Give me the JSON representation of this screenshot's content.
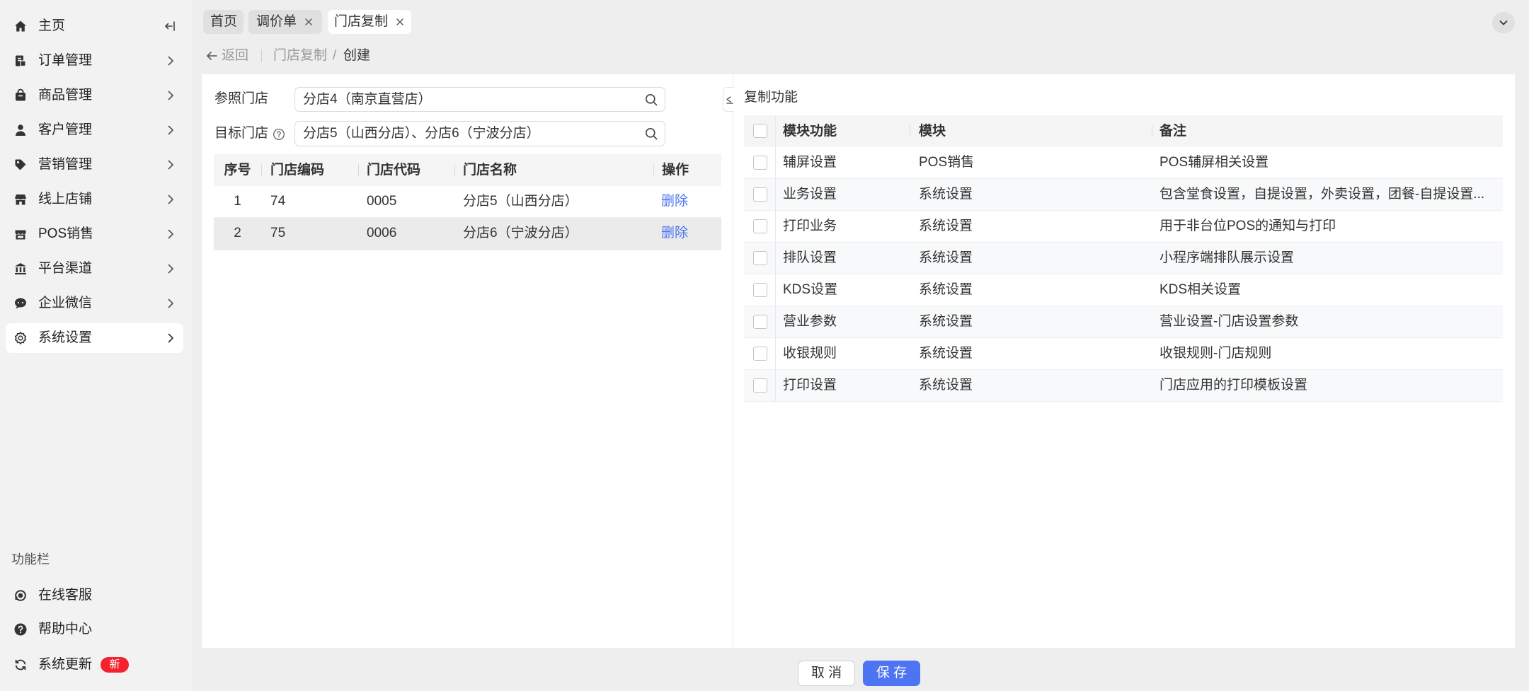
{
  "colors": {
    "accent": "#4d74f2",
    "link": "#4d74f2",
    "badge": "#f5222d"
  },
  "sidebar": {
    "collapse_icon": "collapse-left-icon",
    "items": [
      {
        "label": "主页",
        "icon": "home-icon",
        "active": false
      },
      {
        "label": "订单管理",
        "icon": "order-icon",
        "active": false
      },
      {
        "label": "商品管理",
        "icon": "product-icon",
        "active": false
      },
      {
        "label": "客户管理",
        "icon": "customer-icon",
        "active": false
      },
      {
        "label": "营销管理",
        "icon": "tag-icon",
        "active": false
      },
      {
        "label": "线上店铺",
        "icon": "shop-icon",
        "active": false
      },
      {
        "label": "POS销售",
        "icon": "store-icon",
        "active": false
      },
      {
        "label": "平台渠道",
        "icon": "bank-icon",
        "active": false
      },
      {
        "label": "企业微信",
        "icon": "chat-icon",
        "active": false
      },
      {
        "label": "系统设置",
        "icon": "gear-icon",
        "active": true
      }
    ],
    "function_bar": {
      "title": "功能栏",
      "items": [
        {
          "label": "在线客服",
          "icon": "headset-icon"
        },
        {
          "label": "帮助中心",
          "icon": "help-icon"
        },
        {
          "label": "系统更新",
          "icon": "refresh-icon",
          "badge": "新"
        }
      ]
    }
  },
  "tabs": [
    {
      "label": "首页",
      "closable": false,
      "active": false
    },
    {
      "label": "调价单",
      "closable": true,
      "active": false
    },
    {
      "label": "门店复制",
      "closable": true,
      "active": true
    }
  ],
  "breadcrumb": {
    "back": "返回",
    "parent": "门店复制",
    "separator": "/",
    "current": "创建"
  },
  "store_form": {
    "reference_label": "参照门店",
    "reference_value": "分店4（南京直营店）",
    "target_label": "目标门店",
    "target_value": "分店5（山西分店）、分店6（宁波分店）"
  },
  "store_table": {
    "columns": [
      "序号",
      "门店编码",
      "门店代码",
      "门店名称",
      "操作"
    ],
    "rows": [
      {
        "index": "1",
        "code": "74",
        "short_code": "0005",
        "name": "分店5（山西分店）",
        "action": "删除"
      },
      {
        "index": "2",
        "code": "75",
        "short_code": "0006",
        "name": "分店6（宁波分店）",
        "action": "删除"
      }
    ]
  },
  "copy_functions": {
    "title": "复制功能",
    "columns": [
      "模块功能",
      "模块",
      "备注"
    ],
    "all_checked": false,
    "rows": [
      {
        "function": "辅屏设置",
        "module": "POS销售",
        "remark": "POS辅屏相关设置",
        "checked": false
      },
      {
        "function": "业务设置",
        "module": "系统设置",
        "remark": "包含堂食设置，自提设置，外卖设置，团餐-自提设置...",
        "checked": false
      },
      {
        "function": "打印业务",
        "module": "系统设置",
        "remark": "用于非台位POS的通知与打印",
        "checked": false
      },
      {
        "function": "排队设置",
        "module": "系统设置",
        "remark": "小程序端排队展示设置",
        "checked": false
      },
      {
        "function": "KDS设置",
        "module": "系统设置",
        "remark": "KDS相关设置",
        "checked": false
      },
      {
        "function": "营业参数",
        "module": "系统设置",
        "remark": "营业设置-门店设置参数",
        "checked": false
      },
      {
        "function": "收银规则",
        "module": "系统设置",
        "remark": "收银规则-门店规则",
        "checked": false
      },
      {
        "function": "打印设置",
        "module": "系统设置",
        "remark": "门店应用的打印模板设置",
        "checked": false
      }
    ]
  },
  "footer": {
    "cancel": "取 消",
    "save": "保 存"
  }
}
